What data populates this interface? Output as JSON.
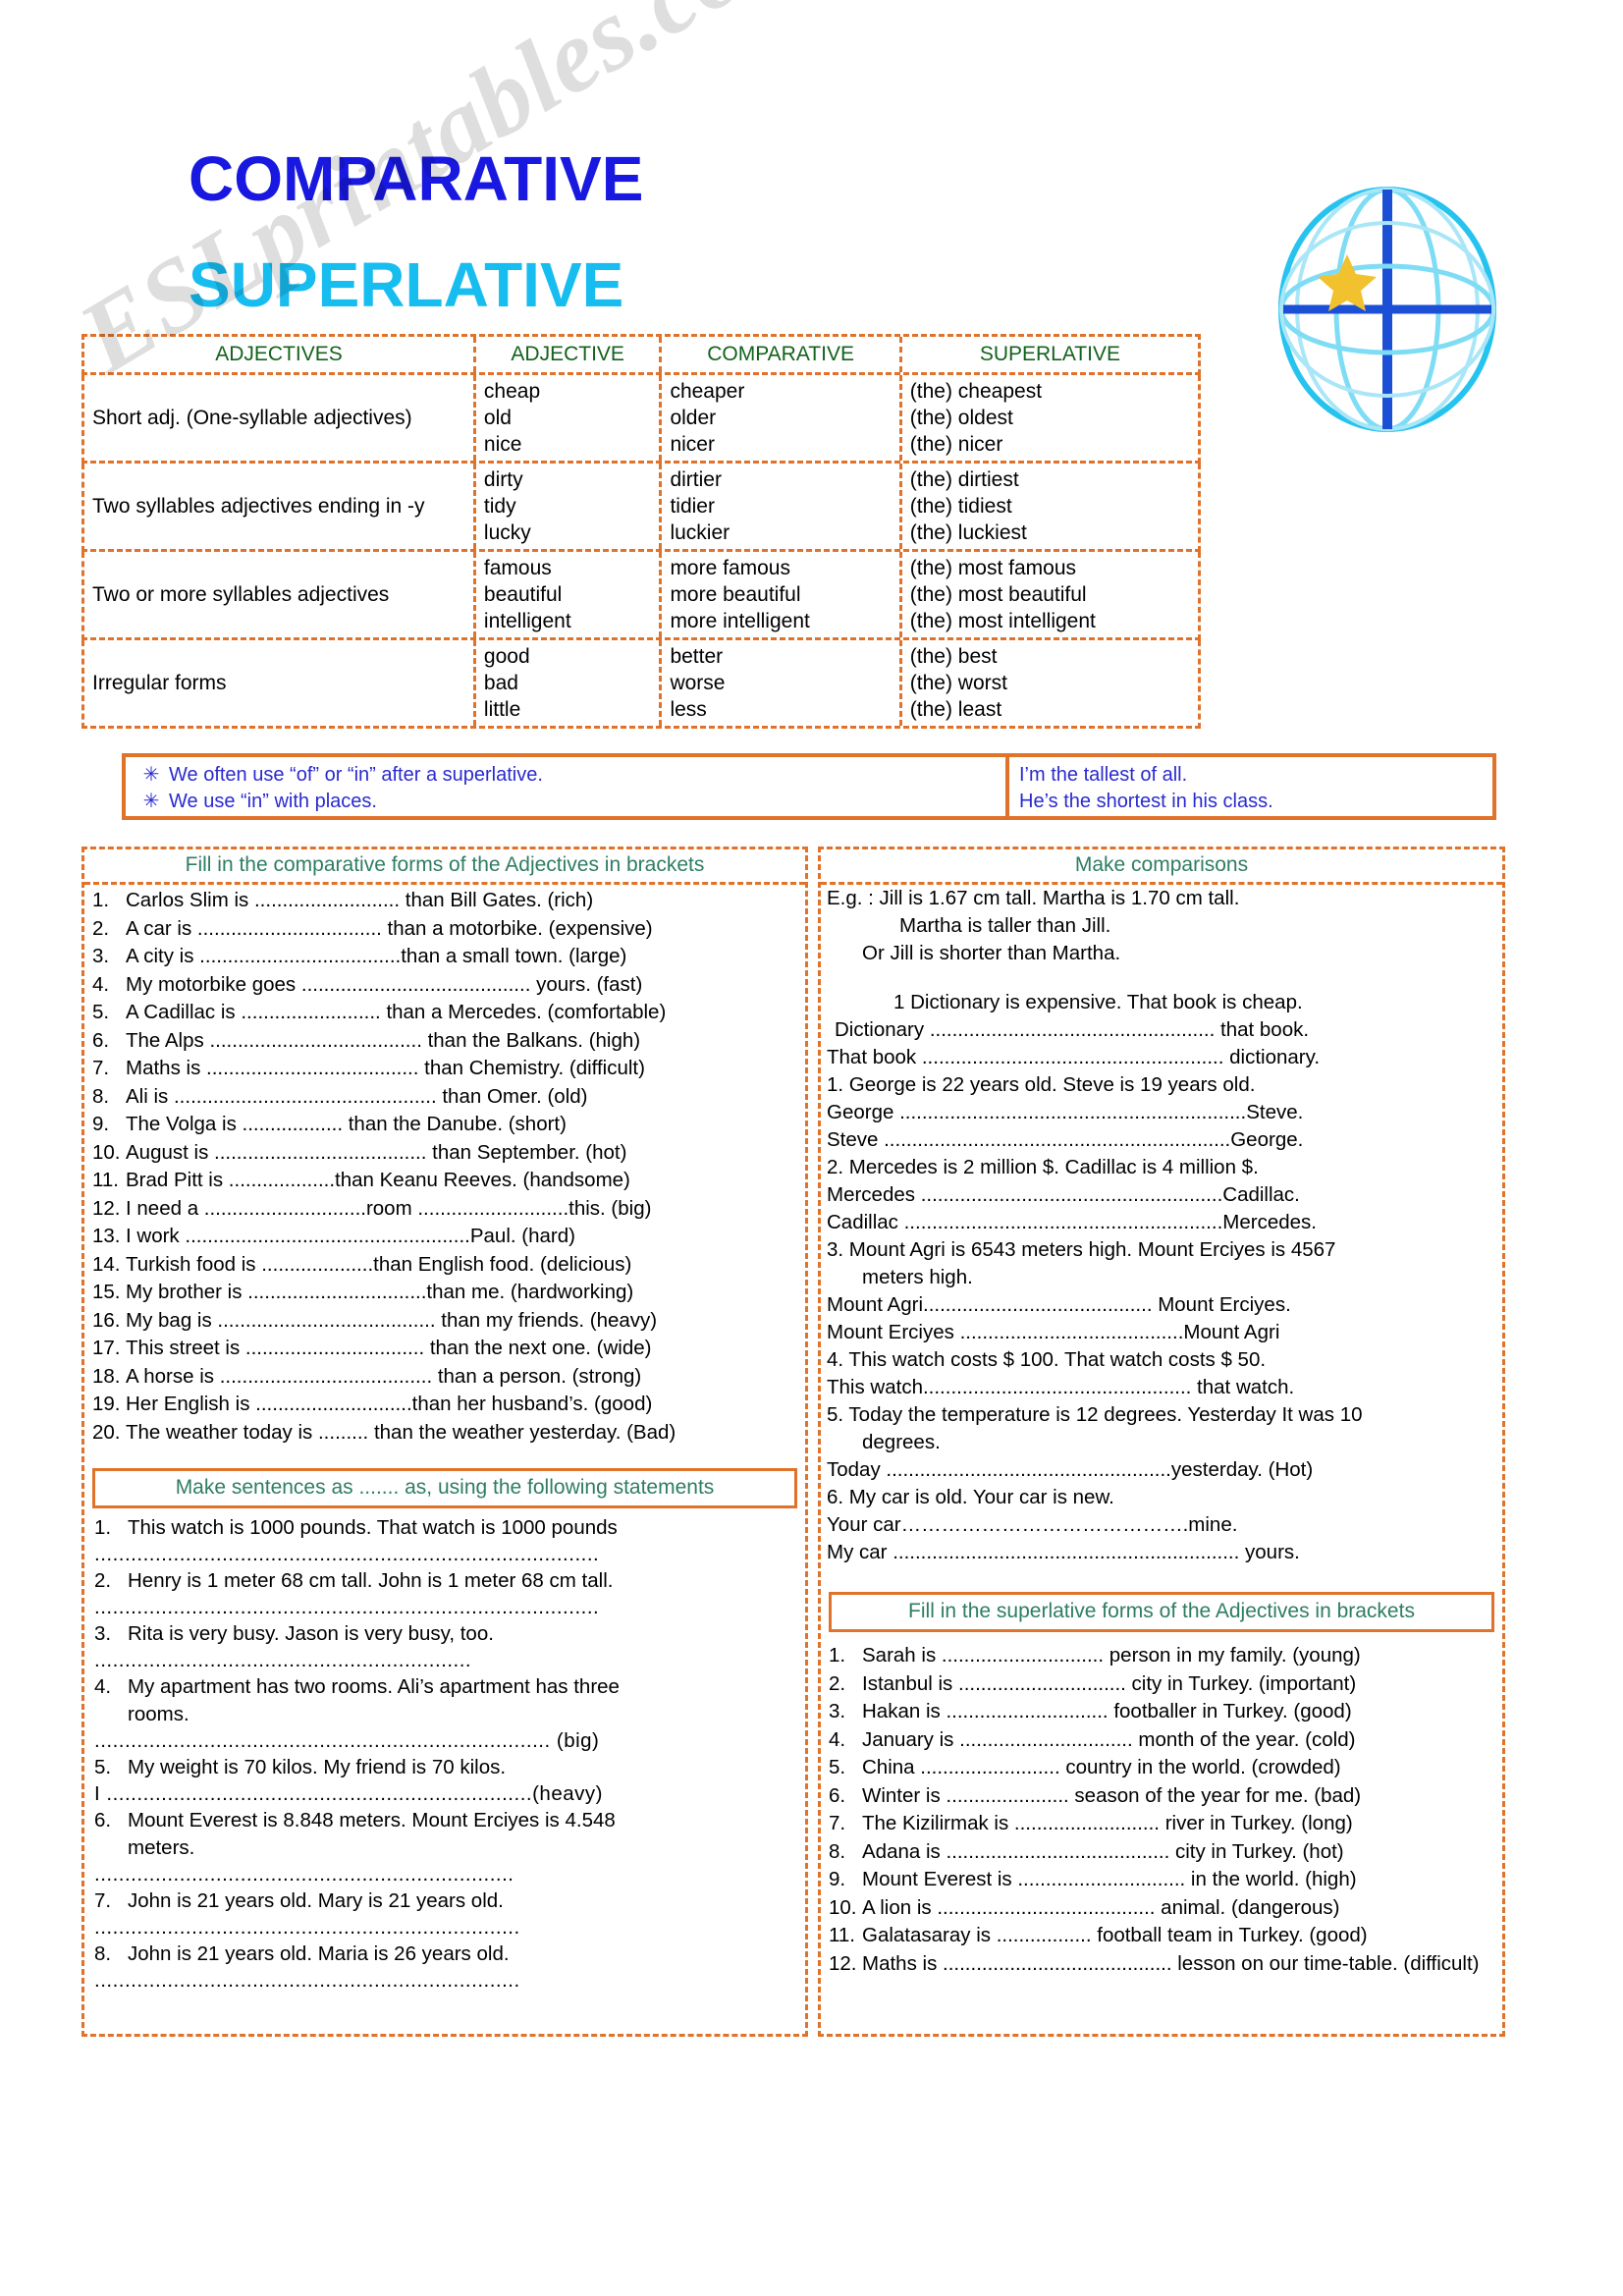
{
  "titles": {
    "comparative": "COMPARATIVE",
    "superlative": "SUPERLATIVE",
    "comparative_color": "#1818e0",
    "superlative_color": "#18bdf0"
  },
  "watermark": "ESLprintables.com",
  "grammar_table": {
    "headers": {
      "rule": "ADJECTIVES",
      "adjective": "ADJECTIVE",
      "comparative": "COMPARATIVE",
      "superlative": "SUPERLATIVE"
    },
    "rows": [
      {
        "rule": "Short adj. (One-syllable adjectives)",
        "adjectives": [
          "cheap",
          "old",
          "nice"
        ],
        "comparatives": [
          "cheaper",
          "older",
          "nicer"
        ],
        "superlatives": [
          "(the) cheapest",
          "(the) oldest",
          "(the) nicer"
        ]
      },
      {
        "rule": "Two syllables adjectives ending in -y",
        "adjectives": [
          "dirty",
          "tidy",
          "lucky"
        ],
        "comparatives": [
          "dirtier",
          "tidier",
          "luckier"
        ],
        "superlatives": [
          "(the) dirtiest",
          "(the) tidiest",
          "(the) luckiest"
        ]
      },
      {
        "rule": "Two or more syllables adjectives",
        "adjectives": [
          "famous",
          "beautiful",
          "intelligent"
        ],
        "comparatives": [
          "more famous",
          "more beautiful",
          "more intelligent"
        ],
        "superlatives": [
          "(the) most famous",
          "(the) most beautiful",
          "(the) most intelligent"
        ]
      },
      {
        "rule": "Irregular forms",
        "adjectives": [
          "good",
          "bad",
          "little"
        ],
        "comparatives": [
          "better",
          "worse",
          "less"
        ],
        "superlatives": [
          "(the) best",
          "(the) worst",
          "(the) least"
        ]
      }
    ]
  },
  "rules_box": {
    "bullet": "✳",
    "rules": [
      "We often use “of” or “in” after a superlative.",
      "We use “in” with places."
    ],
    "examples": [
      "I’m the tallest of all.",
      "He’s the shortest in his class."
    ]
  },
  "comparative_exercise": {
    "heading": "Fill in the  comparative forms of the Adjectives in brackets",
    "items": [
      {
        "n": "1.",
        "text": "Carlos Slim is .......................... than Bill Gates. (rich)"
      },
      {
        "n": "2.",
        "text": "A car is ................................. than a motorbike. (expensive)"
      },
      {
        "n": "3.",
        "text": "A city is  ....................................than a small town. (large)"
      },
      {
        "n": "4.",
        "text": "My motorbike goes ......................................... yours. (fast)"
      },
      {
        "n": "5.",
        "text": "A Cadillac is ......................... than a Mercedes. (comfortable)"
      },
      {
        "n": "6.",
        "text": "The Alps  ...................................... than the Balkans. (high)"
      },
      {
        "n": "7.",
        "text": "Maths is ...................................... than Chemistry. (difficult)"
      },
      {
        "n": "8.",
        "text": "Ali is ............................................... than Omer. (old)"
      },
      {
        "n": "9.",
        "text": "The Volga is .................. than the Danube. (short)"
      },
      {
        "n": "10.",
        "text": "August is ...................................... than September. (hot)"
      },
      {
        "n": "11.",
        "text": "Brad Pitt is ...................than Keanu Reeves. (handsome)"
      },
      {
        "n": "12.",
        "text": "I need a .............................room ...........................this. (big)"
      },
      {
        "n": "13.",
        "text": "I work ...................................................Paul. (hard)"
      },
      {
        "n": "14.",
        "text": "Turkish food is ....................than English food. (delicious)"
      },
      {
        "n": "15.",
        "text": "My brother is ................................than me. (hardworking)"
      },
      {
        "n": "16.",
        "text": "My bag is ....................................... than my friends. (heavy)"
      },
      {
        "n": "17.",
        "text": "This street is ................................ than the next one. (wide)"
      },
      {
        "n": "18.",
        "text": "A horse is ...................................... than a person. (strong)"
      },
      {
        "n": "19.",
        "text": "Her English is ............................than her husband’s. (good)"
      },
      {
        "n": "20.",
        "text": "The weather today is ......... than the weather yesterday. (Bad)"
      }
    ]
  },
  "as_as_exercise": {
    "heading": "Make sentences as ....... as, using the following statements",
    "dots": "...................................................................................",
    "items": [
      {
        "n": "1.",
        "lines": [
          "This watch is 1000 pounds. That watch is 1000 pounds"
        ],
        "answer_dots": "...................................................................................",
        "tag": ""
      },
      {
        "n": "2.",
        "lines": [
          "Henry is 1 meter 68 cm tall. John is 1 meter 68 cm tall."
        ],
        "answer_dots": "...................................................................................",
        "tag": ""
      },
      {
        "n": "3.",
        "lines": [
          "Rita is very busy. Jason is very busy, too."
        ],
        "answer_dots": "..............................................................",
        "tag": ""
      },
      {
        "n": "4.",
        "lines": [
          "My apartment has two rooms. Ali’s apartment has three",
          "rooms."
        ],
        "answer_dots": "...........................................................................",
        "tag": " (big)"
      },
      {
        "n": "5.",
        "lines": [
          "My weight is 70 kilos. My friend is 70 kilos."
        ],
        "answer_dots": "I ......................................................................",
        "tag": "(heavy)"
      },
      {
        "n": "6.",
        "lines": [
          "Mount Everest is 8.848 meters. Mount Erciyes is 4.548",
          "meters."
        ],
        "answer_dots": ".....................................................................",
        "tag": ""
      },
      {
        "n": "7.",
        "lines": [
          "John is 21 years old. Mary is 21 years old."
        ],
        "answer_dots": "......................................................................",
        "tag": ""
      },
      {
        "n": "8.",
        "lines": [
          "John is 21 years old. Maria is 26 years old."
        ],
        "answer_dots": "......................................................................",
        "tag": ""
      }
    ]
  },
  "comparisons_exercise": {
    "heading": "Make comparisons",
    "example_lines": [
      "E.g.    : Jill is 1.67 cm tall. Martha is 1.70 cm tall.",
      "Martha is taller than Jill.",
      "Or   Jill is shorter than Martha."
    ],
    "items": [
      {
        "prompt": "1     Dictionary is expensive. That book is cheap.",
        "answers": [
          "Dictionary  ................................................... that book.",
          "That book  ...................................................... dictionary."
        ]
      },
      {
        "prompt": "1.   George is 22 years old. Steve is 19 years old.",
        "answers": [
          "George ..............................................................Steve.",
          "Steve ..............................................................George."
        ]
      },
      {
        "prompt": "2.   Mercedes is 2 million $. Cadillac is 4 million $.",
        "answers": [
          "Mercedes ......................................................Cadillac.",
          "Cadillac .........................................................Mercedes."
        ]
      },
      {
        "prompt": "3.   Mount Agri is 6543 meters high. Mount Erciyes is 4567",
        "prompt_cont": "meters high.",
        "answers": [
          "Mount Agri......................................... Mount Erciyes.",
          "Mount Erciyes ........................................Mount Agri"
        ]
      },
      {
        "prompt": "4.   This watch costs $ 100. That watch costs $ 50.",
        "answers": [
          "This watch................................................ that watch."
        ]
      },
      {
        "prompt": "5.   Today the temperature is 12 degrees. Yesterday It was 10",
        "prompt_cont": "degrees.",
        "answers": [
          "Today ...................................................yesterday. (Hot)"
        ]
      },
      {
        "prompt": "6.   My car is old. Your car is new.",
        "answers": [
          "Your car…………………………………….mine.",
          "My car .............................................................. yours."
        ]
      }
    ]
  },
  "superlative_exercise": {
    "heading": "Fill in the superlative forms of the Adjectives in brackets",
    "items": [
      {
        "n": "1.",
        "text": "Sarah is ............................. person in my family. (young)"
      },
      {
        "n": "2.",
        "text": "Istanbul is .............................. city in Turkey. (important)"
      },
      {
        "n": "3.",
        "text": "Hakan is ............................. footballer in Turkey. (good)"
      },
      {
        "n": "4.",
        "text": "January is ............................... month of the year. (cold)"
      },
      {
        "n": "5.",
        "text": "China  ......................... country in the world. (crowded)"
      },
      {
        "n": "6.",
        "text": "Winter is ...................... season of the year for me. (bad)"
      },
      {
        "n": "7.",
        "text": "The Kizilirmak is .......................... river in Turkey. (long)"
      },
      {
        "n": "8.",
        "text": "Adana is ........................................ city in Turkey. (hot)"
      },
      {
        "n": "9.",
        "text": "Mount Everest is .............................. in the world. (high)"
      },
      {
        "n": "10.",
        "text": "A lion is ....................................... animal. (dangerous)"
      },
      {
        "n": "11.",
        "text": "Galatasaray is ................. football team in Turkey. (good)"
      },
      {
        "n": "12.",
        "text": "Maths is ......................................... lesson on our time-table. (difficult)"
      }
    ]
  },
  "colors": {
    "dash_orange": "#e0722a",
    "heading_green": "#2e7d63",
    "table_head_green": "#13621c",
    "rule_blue": "#2a2ad0"
  }
}
